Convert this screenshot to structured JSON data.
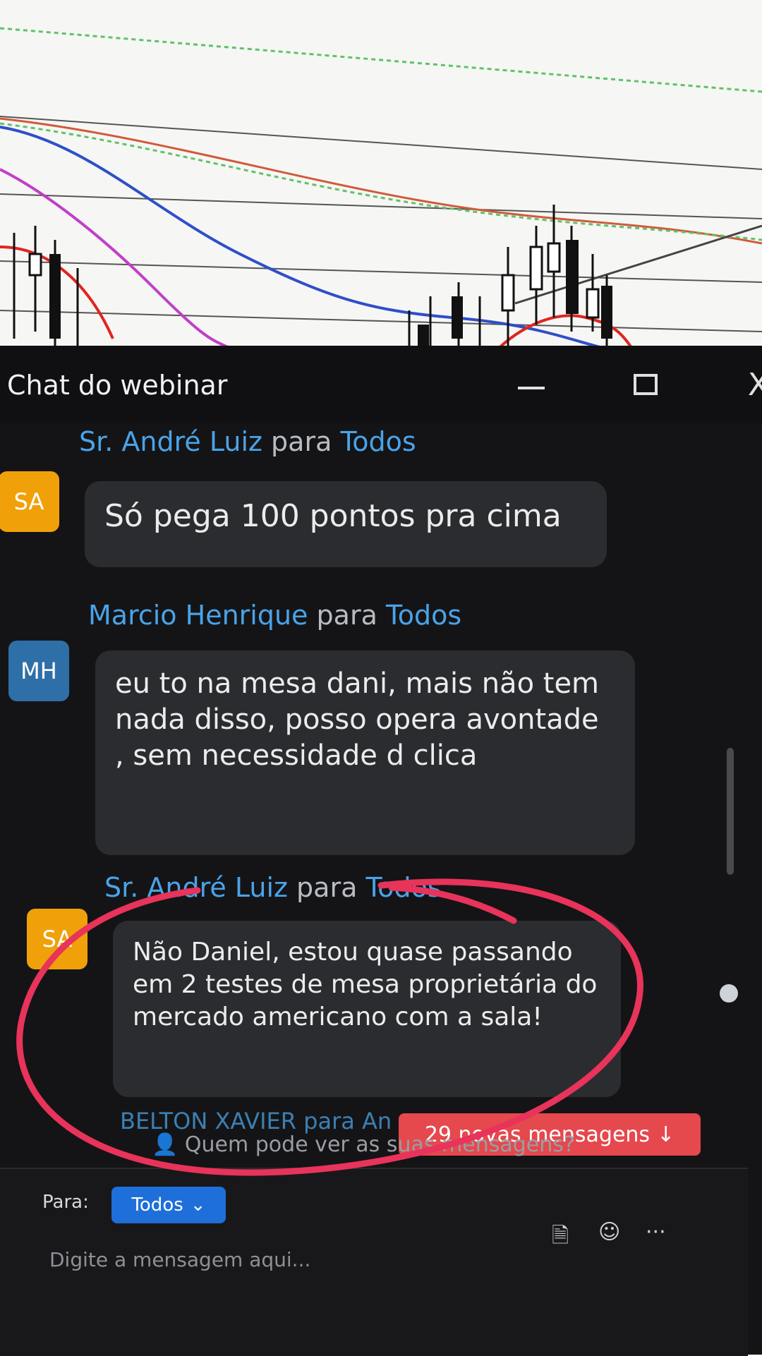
{
  "window": {
    "title": "Chat do webinar",
    "controls": {
      "minimize": "—",
      "maximize": "□",
      "close": "X"
    }
  },
  "messages": [
    {
      "sender": "Sr. André Luiz",
      "connector": "para",
      "recipient": "Todos",
      "initials": "SA",
      "avatar_color": "#f0a10a",
      "text": "Só pega 100 pontos pra cima"
    },
    {
      "sender": "Marcio Henrique",
      "connector": "para",
      "recipient": "Todos",
      "initials": "MH",
      "avatar_color": "#2f6fa8",
      "text": "eu to na mesa dani, mais não tem nada disso, posso opera avontade , sem necessidade d clica"
    },
    {
      "sender": "Sr. André Luiz",
      "connector": "para",
      "recipient": "Todos",
      "initials": "SA",
      "avatar_color": "#f0a10a",
      "text": "Não Daniel, estou quase passando em 2 testes de mesa proprietária do mercado americano com a sala!"
    }
  ],
  "partial_next": "BELTON XAVIER para An",
  "new_messages_button": {
    "label": "29 novas mensagens",
    "icon": "↓"
  },
  "visibility_note": {
    "icon": "person-lock-icon",
    "text": "Quem pode ver as suas mensagens?"
  },
  "composer": {
    "to_label": "Para:",
    "to_value": "Todos",
    "placeholder": "Digite a mensagem aqui...",
    "tools": {
      "file": "🗎",
      "emoji": "☺",
      "more": "···"
    }
  },
  "colors": {
    "accent": "#4aa3e8",
    "alert": "#e5484d",
    "annotation": "#e8335a"
  }
}
